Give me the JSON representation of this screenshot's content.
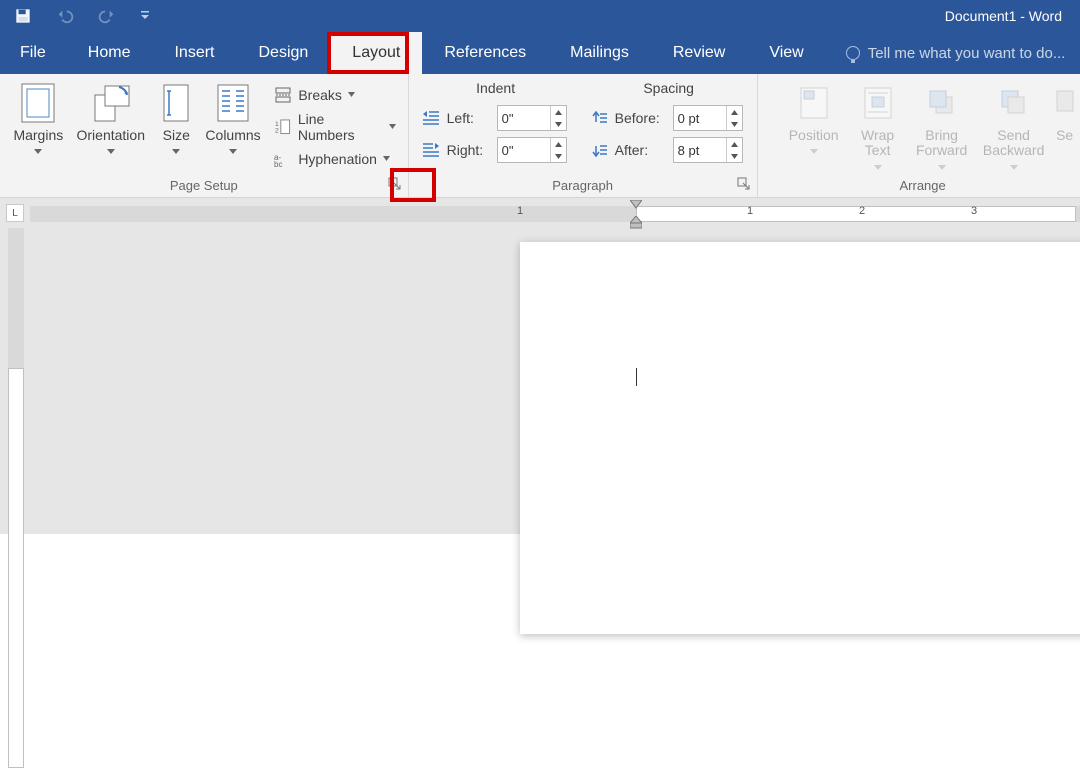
{
  "app": {
    "title": "Document1 - Word"
  },
  "tabs": {
    "file": "File",
    "items": [
      "Home",
      "Insert",
      "Design",
      "Layout",
      "References",
      "Mailings",
      "Review",
      "View"
    ],
    "active_index": 3,
    "tell_me": "Tell me what you want to do..."
  },
  "page_setup": {
    "label": "Page Setup",
    "margins": "Margins",
    "orientation": "Orientation",
    "size": "Size",
    "columns": "Columns",
    "breaks": "Breaks",
    "line_numbers": "Line Numbers",
    "hyphenation": "Hyphenation"
  },
  "paragraph": {
    "label": "Paragraph",
    "indent_header": "Indent",
    "spacing_header": "Spacing",
    "left_label": "Left:",
    "right_label": "Right:",
    "before_label": "Before:",
    "after_label": "After:",
    "left_value": "0\"",
    "right_value": "0\"",
    "before_value": "0 pt",
    "after_value": "8 pt"
  },
  "arrange": {
    "label": "Arrange",
    "position": "Position",
    "wrap_text": "Wrap Text",
    "bring_forward": "Bring Forward",
    "send_backward": "Send Backward",
    "selection_initial": "Se"
  },
  "ruler": {
    "nums": [
      "1",
      "2",
      "3"
    ]
  },
  "icons": {
    "save": "save-icon",
    "undo": "undo-icon",
    "redo": "redo-icon",
    "qat_more": "qat-more-icon",
    "bulb": "bulb-icon"
  }
}
